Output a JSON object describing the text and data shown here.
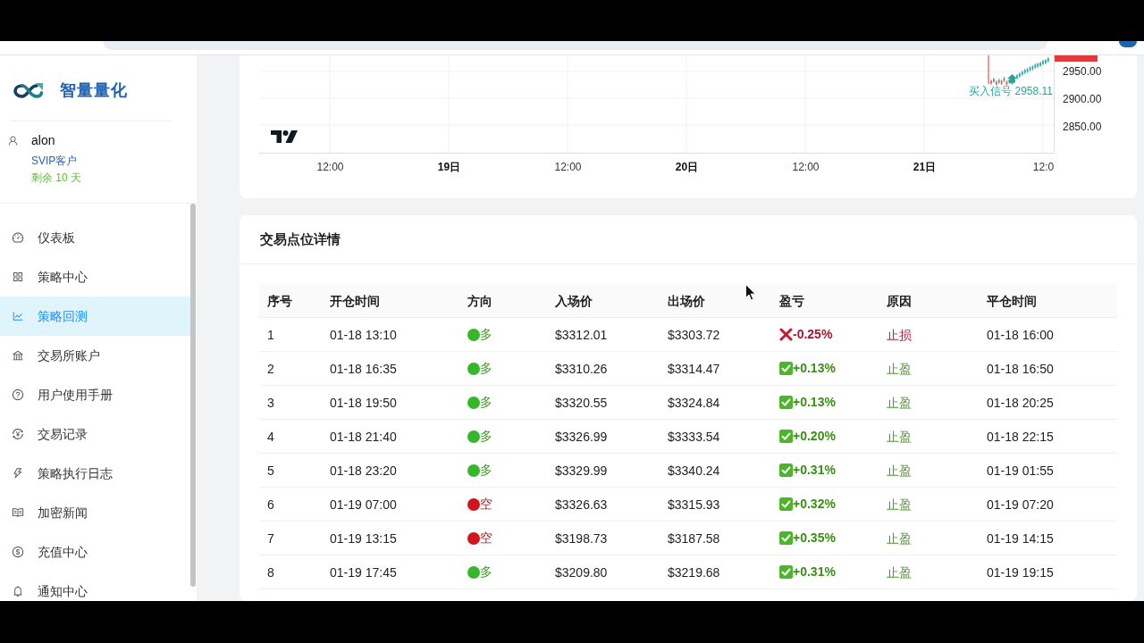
{
  "sidebar": {
    "brand": "智量量化",
    "user": {
      "name": "alon",
      "tier": "SVIP客户",
      "remaining": "剩余 10 天"
    },
    "menu": [
      {
        "label": "仪表板",
        "selected": false
      },
      {
        "label": "策略中心",
        "selected": false
      },
      {
        "label": "策略回测",
        "selected": true
      },
      {
        "label": "交易所账户",
        "selected": false
      },
      {
        "label": "用户使用手册",
        "selected": false
      },
      {
        "label": "交易记录",
        "selected": false
      },
      {
        "label": "策略执行日志",
        "selected": false
      },
      {
        "label": "加密新闻",
        "selected": false
      },
      {
        "label": "充值中心",
        "selected": false
      },
      {
        "label": "通知中心",
        "selected": false
      }
    ]
  },
  "chart": {
    "price_labels": [
      "2950.00",
      "2900.00",
      "2850.00"
    ],
    "time_labels": [
      {
        "text": "12:00",
        "kind": "time"
      },
      {
        "text": "19日",
        "kind": "day"
      },
      {
        "text": "12:00",
        "kind": "time"
      },
      {
        "text": "20日",
        "kind": "day"
      },
      {
        "text": "12:00",
        "kind": "time"
      },
      {
        "text": "21日",
        "kind": "day"
      },
      {
        "text": "12:0",
        "kind": "time"
      }
    ],
    "signal": "买入信号 2958.11"
  },
  "trades": {
    "title": "交易点位详情",
    "columns": [
      "序号",
      "开仓时间",
      "方向",
      "入场价",
      "出场价",
      "盈亏",
      "原因",
      "平仓时间"
    ],
    "rows": [
      {
        "index": "1",
        "open_time": "01-18 13:10",
        "direction": {
          "kind": "long",
          "text": "多"
        },
        "entry": "$3312.01",
        "exit": "$3303.72",
        "pnl": {
          "kind": "loss",
          "text": "-0.25%"
        },
        "reason": {
          "kind": "loss",
          "text": "止损"
        },
        "close_time": "01-18 16:00"
      },
      {
        "index": "2",
        "open_time": "01-18 16:35",
        "direction": {
          "kind": "long",
          "text": "多"
        },
        "entry": "$3310.26",
        "exit": "$3314.47",
        "pnl": {
          "kind": "gain",
          "text": "+0.13%"
        },
        "reason": {
          "kind": "gain",
          "text": "止盈"
        },
        "close_time": "01-18 16:50"
      },
      {
        "index": "3",
        "open_time": "01-18 19:50",
        "direction": {
          "kind": "long",
          "text": "多"
        },
        "entry": "$3320.55",
        "exit": "$3324.84",
        "pnl": {
          "kind": "gain",
          "text": "+0.13%"
        },
        "reason": {
          "kind": "gain",
          "text": "止盈"
        },
        "close_time": "01-18 20:25"
      },
      {
        "index": "4",
        "open_time": "01-18 21:40",
        "direction": {
          "kind": "long",
          "text": "多"
        },
        "entry": "$3326.99",
        "exit": "$3333.54",
        "pnl": {
          "kind": "gain",
          "text": "+0.20%"
        },
        "reason": {
          "kind": "gain",
          "text": "止盈"
        },
        "close_time": "01-18 22:15"
      },
      {
        "index": "5",
        "open_time": "01-18 23:20",
        "direction": {
          "kind": "long",
          "text": "多"
        },
        "entry": "$3329.99",
        "exit": "$3340.24",
        "pnl": {
          "kind": "gain",
          "text": "+0.31%"
        },
        "reason": {
          "kind": "gain",
          "text": "止盈"
        },
        "close_time": "01-19 01:55"
      },
      {
        "index": "6",
        "open_time": "01-19 07:00",
        "direction": {
          "kind": "short",
          "text": "空"
        },
        "entry": "$3326.63",
        "exit": "$3315.93",
        "pnl": {
          "kind": "gain",
          "text": "+0.32%"
        },
        "reason": {
          "kind": "gain",
          "text": "止盈"
        },
        "close_time": "01-19 07:20"
      },
      {
        "index": "7",
        "open_time": "01-19 13:15",
        "direction": {
          "kind": "short",
          "text": "空"
        },
        "entry": "$3198.73",
        "exit": "$3187.58",
        "pnl": {
          "kind": "gain",
          "text": "+0.35%"
        },
        "reason": {
          "kind": "gain",
          "text": "止盈"
        },
        "close_time": "01-19 14:15"
      },
      {
        "index": "8",
        "open_time": "01-19 17:45",
        "direction": {
          "kind": "long",
          "text": "多"
        },
        "entry": "$3209.80",
        "exit": "$3219.68",
        "pnl": {
          "kind": "gain",
          "text": "+0.31%"
        },
        "reason": {
          "kind": "gain",
          "text": "止盈"
        },
        "close_time": "01-19 19:15"
      }
    ]
  }
}
